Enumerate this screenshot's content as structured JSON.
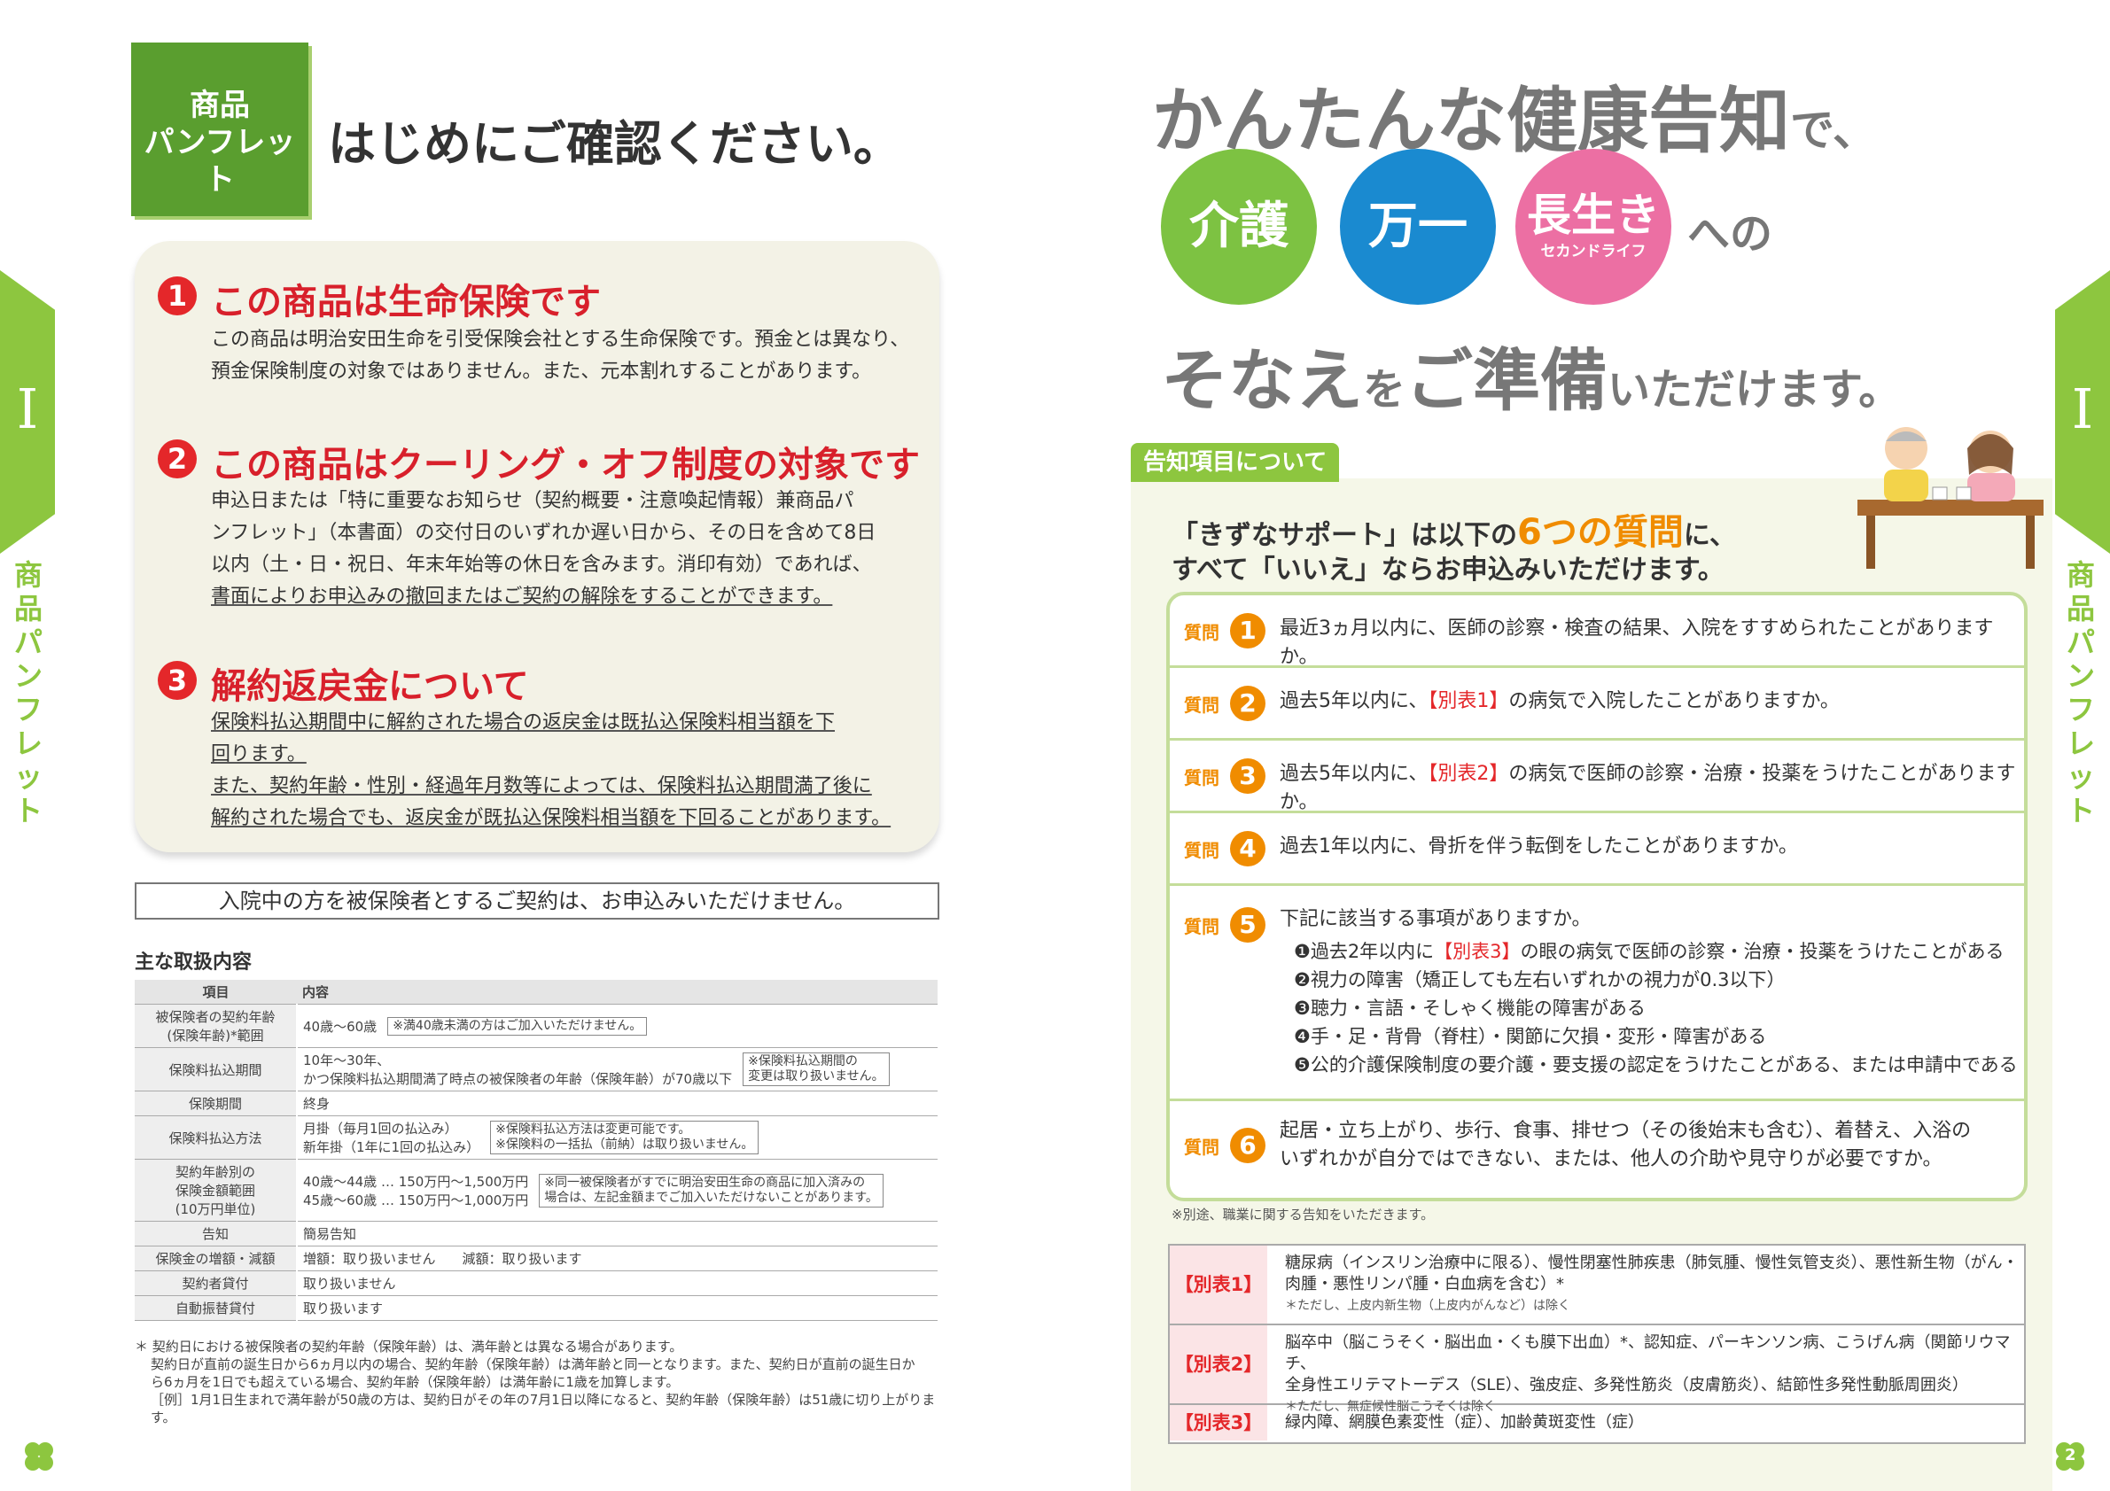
{
  "left": {
    "badge": [
      "商品",
      "パンフレット"
    ],
    "heading": "はじめにご確認ください。",
    "side_roman": "I",
    "side_label": "商品パンフレット",
    "points": [
      {
        "num": "1",
        "title": "この商品は生命保険です",
        "lines": [
          "この商品は明治安田生命を引受保険会社とする生命保険です。預金とは異なり、",
          "預金保険制度の対象ではありません。また、元本割れすることがあります。"
        ]
      },
      {
        "num": "2",
        "title": "この商品はクーリング・オフ制度の対象です",
        "lines": [
          "申込日または「特に重要なお知らせ（契約概要・注意喚起情報）兼商品パ",
          "ンフレット」（本書面）の交付日のいずれか遅い日から、その日を含めて8日",
          "以内（土・日・祝日、年末年始等の休日を含みます。消印有効）であれば、",
          "書面によりお申込みの撤回またはご契約の解除をすることができます。"
        ]
      },
      {
        "num": "3",
        "title": "解約返戻金について",
        "lines": [
          "保険料払込期間中に解約された場合の返戻金は既払込保険料相当額を下",
          "回ります。",
          "また、契約年齢・性別・経過年月数等によっては、保険料払込期間満了後に",
          "解約された場合でも、返戻金が既払込保険料相当額を下回ることがあります。"
        ]
      }
    ],
    "warning": "入院中の方を被保険者とするご契約は、お申込みいただけません。",
    "table_title": "主な取扱内容",
    "table_head": [
      "項目",
      "内容"
    ],
    "rows": [
      {
        "k": "被保険者の契約年齢\n(保険年齢)*範囲",
        "v": "40歳～60歳",
        "note": "※満40歳未満の方はご加入いただけません。"
      },
      {
        "k": "保険料払込期間",
        "v": "10年～30年、\nかつ保険料払込期間満了時点の被保険者の年齢（保険年齢）が70歳以下",
        "note": "※保険料払込期間の\n変更は取り扱いません。"
      },
      {
        "k": "保険期間",
        "v": "終身",
        "note": ""
      },
      {
        "k": "保険料払込方法",
        "v": "月掛（毎月1回の払込み）\n新年掛（1年に1回の払込み）",
        "note": "※保険料払込方法は変更可能です。\n※保険料の一括払（前納）は取り扱いません。"
      },
      {
        "k": "契約年齢別の\n保険金額範囲\n(10万円単位)",
        "v": "40歳～44歳 … 150万円～1,500万円\n45歳～60歳 … 150万円～1,000万円",
        "note": "※同一被保険者がすでに明治安田生命の商品に加入済みの\n場合は、左記金額までご加入いただけないことがあります。"
      },
      {
        "k": "告知",
        "v": "簡易告知",
        "note": ""
      },
      {
        "k": "保険金の増額・減額",
        "v": "増額：取り扱いません　　減額：取り扱います",
        "note": ""
      },
      {
        "k": "契約者貸付",
        "v": "取り扱いません",
        "note": ""
      },
      {
        "k": "自動振替貸付",
        "v": "取り扱います",
        "note": ""
      }
    ],
    "footnote": [
      "＊ 契約日における被保険者の契約年齢（保険年齢）は、満年齢とは異なる場合があります。",
      "契約日が直前の誕生日から6ヵ月以内の場合、契約年齢（保険年齢）は満年齢と同一となります。また、契約日が直前の誕生日か",
      "ら6ヵ月を1日でも超えている場合、契約年齢（保険年齢）は満年齢に1歳を加算します。",
      "［例］1月1日生まれで満年齢が50歳の方は、契約日がその年の7月1日以降になると、契約年齢（保険年齢）は51歳に切り上がります。"
    ]
  },
  "right": {
    "headline1": "かんたんな健康告知",
    "headline1_suffix": "で、",
    "circles": [
      {
        "label": "介護",
        "sub": "",
        "color": "#7dc242"
      },
      {
        "label": "万一",
        "sub": "",
        "color": "#1a8ad0"
      },
      {
        "label": "長生き",
        "sub": "セカンドライフ",
        "color": "#ec6fa3"
      }
    ],
    "headline2_after": "への",
    "headline3_parts": [
      "そなえ",
      "を",
      "ご準備",
      "いただけます。"
    ],
    "tag": "告知項目について",
    "intro1_a": "「きずなサポート」は以下の",
    "intro1_b": "6つの質問",
    "intro1_c": "に、",
    "intro2": "すべて「いいえ」ならお申込みいただけます。",
    "q_label": "質問",
    "questions": [
      {
        "n": "1",
        "pre": "最近3ヵ月以内に、医師の診察・検査の結果、入院をすすめられたことがありますか。",
        "ref": "",
        "post": ""
      },
      {
        "n": "2",
        "pre": "過去5年以内に、",
        "ref": "【別表1】",
        "post": "の病気で入院したことがありますか。"
      },
      {
        "n": "3",
        "pre": "過去5年以内に、",
        "ref": "【別表2】",
        "post": "の病気で医師の診察・治療・投薬をうけたことがありますか。"
      },
      {
        "n": "4",
        "pre": "過去1年以内に、骨折を伴う転倒をしたことがありますか。",
        "ref": "",
        "post": ""
      }
    ],
    "q5": {
      "n": "5",
      "lead": "下記に該当する事項がありますか。",
      "items": [
        {
          "pre": "❶過去2年以内に",
          "ref": "【別表3】",
          "post": "の眼の病気で医師の診察・治療・投薬をうけたことがある"
        },
        {
          "pre": "❷視力の障害（矯正しても左右いずれかの視力が0.3以下）",
          "ref": "",
          "post": ""
        },
        {
          "pre": "❸聴力・言語・そしゃく機能の障害がある",
          "ref": "",
          "post": ""
        },
        {
          "pre": "❹手・足・背骨（脊柱）・関節に欠損・変形・障害がある",
          "ref": "",
          "post": ""
        },
        {
          "pre": "❺公的介護保険制度の要介護・要支援の認定をうけたことがある、または申請中である",
          "ref": "",
          "post": ""
        }
      ]
    },
    "q6": {
      "n": "6",
      "lines": [
        "起居・立ち上がり、歩行、食事、排せつ（その後始末も含む）、着替え、入浴の",
        "いずれかが自分ではできない、または、他人の介助や見守りが必要ですか。"
      ]
    },
    "occupation_note": "※別途、職業に関する告知をいただきます。",
    "beppyo": [
      {
        "key": "【別表1】",
        "lines": [
          "糖尿病（インスリン治療中に限る）、慢性閉塞性肺疾患（肺気腫、慢性気管支炎）、悪性新生物（がん・",
          "肉腫・悪性リンパ腫・白血病を含む）*"
        ],
        "note": "＊ただし、上皮内新生物（上皮内がんなど）は除く"
      },
      {
        "key": "【別表2】",
        "lines": [
          "脳卒中（脳こうそく・脳出血・くも膜下出血）*、認知症、パーキンソン病、こうげん病（関節リウマチ、",
          "全身性エリテマトーデス（SLE）、強皮症、多発性筋炎（皮膚筋炎）、結節性多発性動脈周囲炎）"
        ],
        "note": "＊ただし、無症候性脳こうそくは除く"
      },
      {
        "key": "【別表3】",
        "lines": [
          "緑内障、網膜色素変性（症）、加齢黄斑変性（症）"
        ],
        "note": ""
      }
    ],
    "page_num": "2"
  }
}
